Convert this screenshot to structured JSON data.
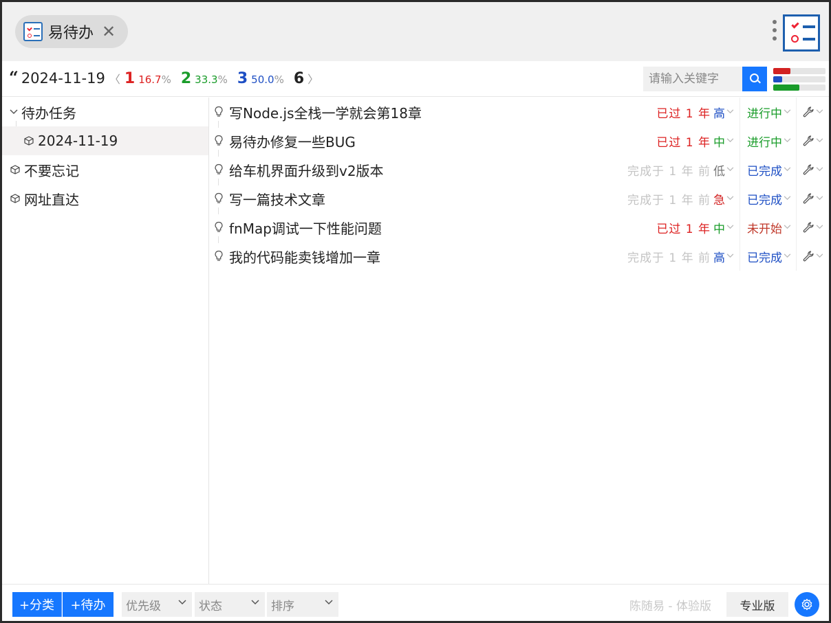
{
  "tab": {
    "title": "易待办",
    "close": "✕"
  },
  "stats": {
    "date": "2024-11-19",
    "prev": "〈",
    "next": "〉",
    "items": [
      {
        "count": "1",
        "percent": "16.7",
        "unit": "%",
        "color": "#d22222"
      },
      {
        "count": "2",
        "percent": "33.3",
        "unit": "%",
        "color": "#1a9c2a"
      },
      {
        "count": "3",
        "percent": "50.0",
        "unit": "%",
        "color": "#1e4fc4"
      }
    ],
    "total": "6"
  },
  "search": {
    "placeholder": "请输入关键字"
  },
  "progress_bars": [
    {
      "fraction": 0.333,
      "color": "#d22222"
    },
    {
      "fraction": 0.167,
      "color": "#1e4fc4"
    },
    {
      "fraction": 0.5,
      "color": "#1a9c2a"
    }
  ],
  "sidebar": {
    "items": [
      {
        "label": "待办任务",
        "icon": "chevron-down-icon"
      },
      {
        "label": "2024-11-19",
        "icon": "cube-icon"
      },
      {
        "label": "不要忘记",
        "icon": "cube-icon"
      },
      {
        "label": "网址直达",
        "icon": "cube-icon"
      }
    ]
  },
  "tasks": [
    {
      "title": "写Node.js全栈一学就会第18章",
      "due": "已过 1 年",
      "due_type": "late",
      "priority": "高",
      "priority_color": "#1e4fc4",
      "status": "进行中",
      "status_color": "#1a9c2a"
    },
    {
      "title": "易待办修复一些BUG",
      "due": "已过 1 年",
      "due_type": "late",
      "priority": "中",
      "priority_color": "#1a9c2a",
      "status": "进行中",
      "status_color": "#1a9c2a"
    },
    {
      "title": "给车机界面升级到v2版本",
      "due": "完成于 1 年 前",
      "due_type": "done",
      "priority": "低",
      "priority_color": "#777777",
      "status": "已完成",
      "status_color": "#1e4fc4"
    },
    {
      "title": "写一篇技术文章",
      "due": "完成于 1 年 前",
      "due_type": "done",
      "priority": "急",
      "priority_color": "#d22222",
      "status": "已完成",
      "status_color": "#1e4fc4"
    },
    {
      "title": "fnMap调试一下性能问题",
      "due": "已过 1 年",
      "due_type": "late",
      "priority": "中",
      "priority_color": "#1a9c2a",
      "status": "未开始",
      "status_color": "#c0392b"
    },
    {
      "title": "我的代码能卖钱增加一章",
      "due": "完成于 1 年 前",
      "due_type": "done",
      "priority": "高",
      "priority_color": "#1e4fc4",
      "status": "已完成",
      "status_color": "#1e4fc4"
    }
  ],
  "footer": {
    "add_category": "+分类",
    "add_todo": "+待办",
    "priority_select": "优先级",
    "status_select": "状态",
    "sort_select": "排序",
    "user": "陈随易 - 体验版",
    "pro_label": "专业版"
  },
  "colors": {
    "accent": "#1677ff",
    "brand": "#1d5fae"
  }
}
